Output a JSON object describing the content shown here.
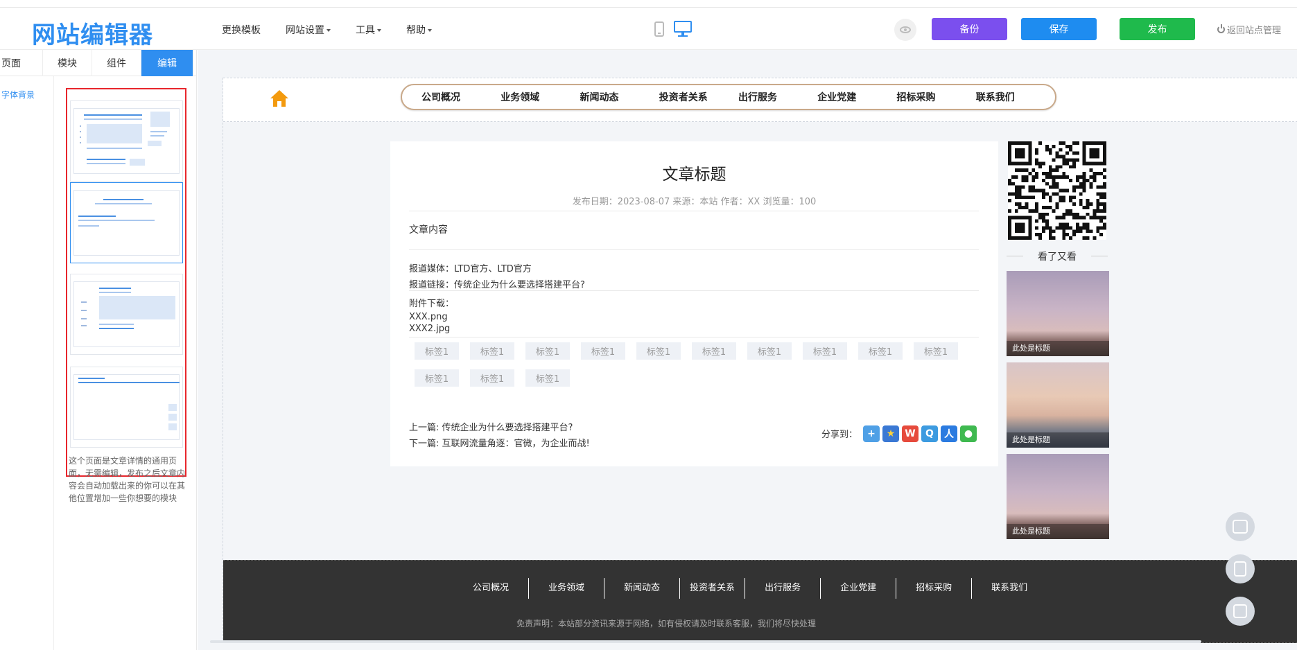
{
  "app": {
    "logo": "网站编辑器",
    "menu": [
      {
        "label": "更换模板",
        "dropdown": false
      },
      {
        "label": "网站设置",
        "dropdown": true
      },
      {
        "label": "工具",
        "dropdown": true
      },
      {
        "label": "帮助",
        "dropdown": true
      }
    ],
    "buttons": {
      "backup": "备份",
      "save": "保存",
      "publish": "发布"
    },
    "return_label": "返回站点管理",
    "colors": {
      "brand": "#2f8ef0",
      "backup": "#7b4fee",
      "save": "#1e8cf0",
      "publish": "#1fba4c",
      "highlight": "#e8262c"
    }
  },
  "left_panel": {
    "tabs": [
      "页面",
      "模块",
      "组件",
      "编辑"
    ],
    "active_tab": "编辑",
    "side_item": "字体背景",
    "description": "这个页面是文章详情的通用页面，无需编辑，发布之后文章内容会自动加载出来的你可以在其他位置增加一些你想要的模块"
  },
  "site": {
    "nav": [
      "公司概况",
      "业务领域",
      "新闻动态",
      "投资者关系",
      "出行服务",
      "企业党建",
      "招标采购",
      "联系我们"
    ],
    "article": {
      "title": "文章标题",
      "meta": "发布日期：2023-08-07  来源：本站  作者：XX  浏览量：100",
      "content": "文章内容",
      "media": "报道媒体：LTD官方、LTD官方",
      "link": "报道链接：传统企业为什么要选择搭建平台?",
      "attachments_label": "附件下载：",
      "attachments": [
        "XXX.png",
        "XXX2.jpg"
      ],
      "tags": [
        "标签1",
        "标签1",
        "标签1",
        "标签1",
        "标签1",
        "标签1",
        "标签1",
        "标签1",
        "标签1",
        "标签1",
        "标签1",
        "标签1",
        "标签1"
      ],
      "prev": "上一篇: 传统企业为什么要选择搭建平台?",
      "next": "下一篇: 互联网流量角逐：官微，为企业而战!",
      "share_label": "分享到："
    },
    "sidebar": {
      "see_more": "看了又看",
      "items": [
        {
          "caption": "此处是标题"
        },
        {
          "caption": "此处是标题"
        },
        {
          "caption": "此处是标题"
        }
      ]
    },
    "footer": {
      "nav": [
        "公司概况",
        "业务领域",
        "新闻动态",
        "投资者关系",
        "出行服务",
        "企业党建",
        "招标采购",
        "联系我们"
      ],
      "disclaimer": "免责声明：本站部分资讯来源于网络，如有侵权请及时联系客服，我们将尽快处理"
    }
  }
}
